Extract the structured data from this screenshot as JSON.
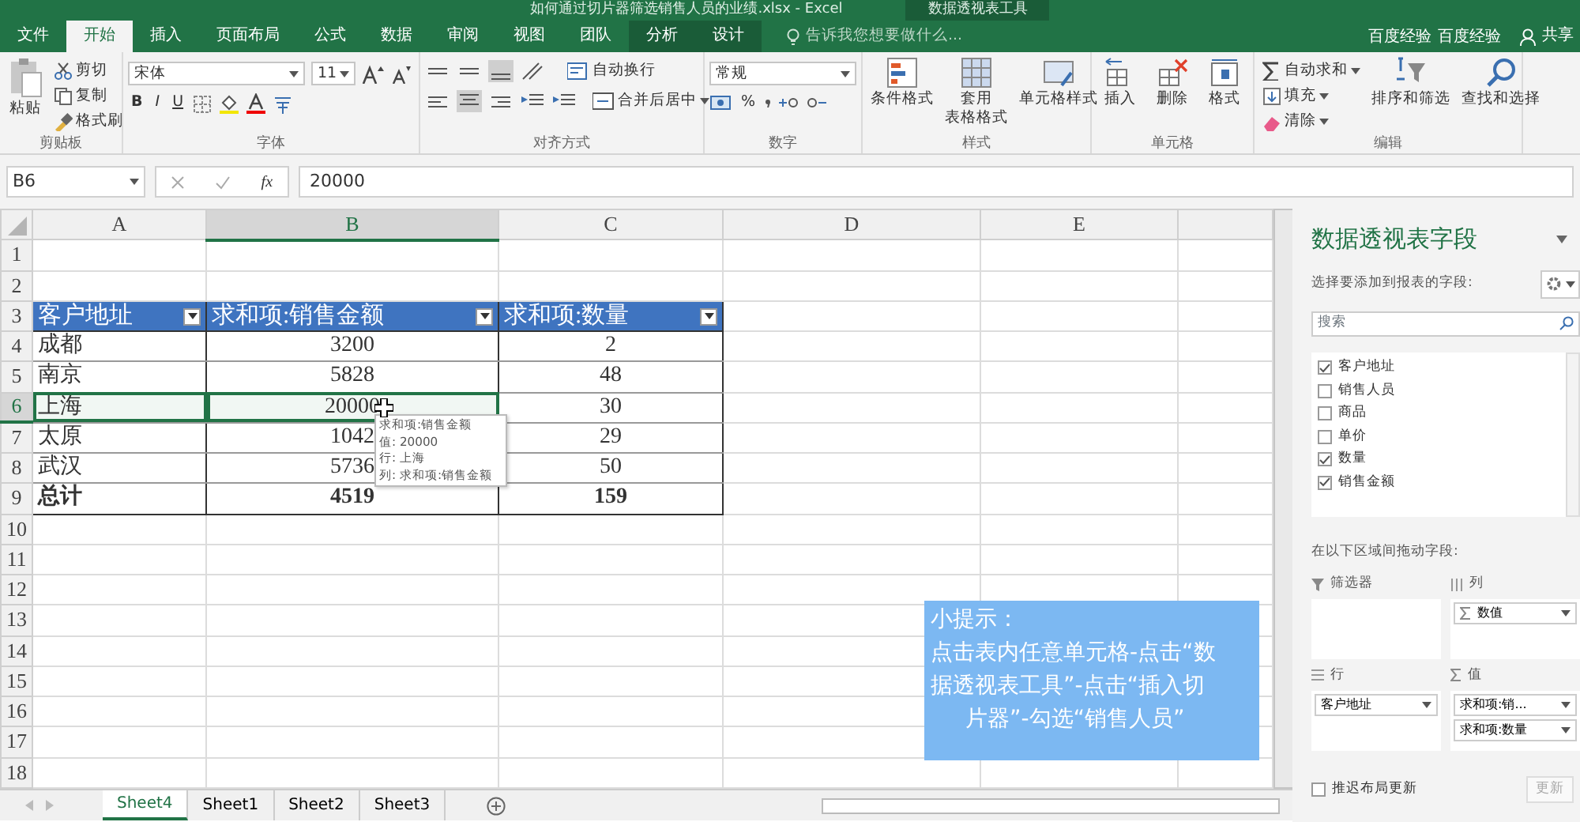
{
  "window": {
    "title": "如何通过切片器筛选销售人员的业绩.xlsx - Excel",
    "context_tab": "数据透视表工具",
    "tell_me": {
      "placeholder": "告诉我您想要做什么..."
    },
    "users": [
      "百度经验",
      "百度经验"
    ],
    "share": "共享"
  },
  "ribbon_tabs": [
    {
      "label": "文件",
      "selected": false,
      "kind": "standard"
    },
    {
      "label": "开始",
      "selected": true,
      "kind": "standard"
    },
    {
      "label": "插入",
      "selected": false,
      "kind": "standard"
    },
    {
      "label": "页面布局",
      "selected": false,
      "kind": "standard"
    },
    {
      "label": "公式",
      "selected": false,
      "kind": "standard"
    },
    {
      "label": "数据",
      "selected": false,
      "kind": "standard"
    },
    {
      "label": "审阅",
      "selected": false,
      "kind": "standard"
    },
    {
      "label": "视图",
      "selected": false,
      "kind": "standard"
    },
    {
      "label": "团队",
      "selected": false,
      "kind": "standard"
    },
    {
      "label": "分析",
      "selected": false,
      "kind": "context"
    },
    {
      "label": "设计",
      "selected": false,
      "kind": "context"
    }
  ],
  "ribbon": {
    "clipboard": {
      "label": "剪贴板",
      "paste": "粘贴",
      "commands": [
        "剪切",
        "复制",
        "格式刷"
      ]
    },
    "font": {
      "label": "字体",
      "font_name": "宋体",
      "font_size": "11",
      "bold": "B",
      "italic": "I",
      "underline": "U"
    },
    "alignment": {
      "label": "对齐方式",
      "wrap": "自动换行",
      "merge": "合并后居中"
    },
    "number": {
      "label": "数字",
      "format": "常规",
      "percent": "%"
    },
    "styles": {
      "label": "样式",
      "commands": [
        {
          "lines": [
            "条件格式"
          ]
        },
        {
          "lines": [
            "套用",
            "表格格式"
          ]
        },
        {
          "lines": [
            "单元格样式"
          ]
        }
      ]
    },
    "cells": {
      "label": "单元格",
      "commands": [
        "插入",
        "删除",
        "格式"
      ]
    },
    "editing": {
      "label": "编辑",
      "small": [
        "自动求和",
        "填充",
        "清除"
      ],
      "large": [
        "排序和筛选",
        "查找和选择"
      ]
    }
  },
  "formula_bar": {
    "name_box": "B6",
    "fx": "fx",
    "value": "20000"
  },
  "columns": [
    {
      "label": "A",
      "selected": false
    },
    {
      "label": "B",
      "selected": true
    },
    {
      "label": "C",
      "selected": false
    },
    {
      "label": "D",
      "selected": false
    },
    {
      "label": "E",
      "selected": false
    }
  ],
  "rows": [
    {
      "label": "1",
      "selected": false,
      "kind": "empty"
    },
    {
      "label": "2",
      "selected": false,
      "kind": "empty"
    },
    {
      "label": "3",
      "selected": false,
      "kind": "header",
      "cells": [
        {
          "text": "客户地址",
          "selected": false
        },
        {
          "text": "求和项:销售金额",
          "selected": false
        },
        {
          "text": "求和项:数量",
          "selected": false
        }
      ]
    },
    {
      "label": "4",
      "selected": false,
      "kind": "data",
      "cells": [
        {
          "text": "成都",
          "selected": false
        },
        {
          "text": "3200",
          "selected": false
        },
        {
          "text": "2",
          "selected": false
        }
      ]
    },
    {
      "label": "5",
      "selected": false,
      "kind": "data",
      "cells": [
        {
          "text": "南京",
          "selected": false
        },
        {
          "text": "5828",
          "selected": false
        },
        {
          "text": "48",
          "selected": false
        }
      ]
    },
    {
      "label": "6",
      "selected": true,
      "kind": "data",
      "cells": [
        {
          "text": "上海",
          "selected": true
        },
        {
          "text": "20000",
          "selected": true
        },
        {
          "text": "30",
          "selected": false
        }
      ]
    },
    {
      "label": "7",
      "selected": false,
      "kind": "data",
      "cells": [
        {
          "text": "太原",
          "selected": false
        },
        {
          "text": "1042",
          "selected": false
        },
        {
          "text": "29",
          "selected": false
        }
      ]
    },
    {
      "label": "8",
      "selected": false,
      "kind": "data",
      "cells": [
        {
          "text": "武汉",
          "selected": false
        },
        {
          "text": "5736",
          "selected": false
        },
        {
          "text": "50",
          "selected": false
        }
      ]
    },
    {
      "label": "9",
      "selected": false,
      "kind": "total",
      "cells": [
        {
          "text": "总计",
          "selected": false
        },
        {
          "text": "4519",
          "selected": false
        },
        {
          "text": "159",
          "selected": false
        }
      ]
    },
    {
      "label": "10",
      "selected": false,
      "kind": "empty"
    },
    {
      "label": "11",
      "selected": false,
      "kind": "empty"
    },
    {
      "label": "12",
      "selected": false,
      "kind": "empty"
    },
    {
      "label": "13",
      "selected": false,
      "kind": "empty"
    },
    {
      "label": "14",
      "selected": false,
      "kind": "empty"
    },
    {
      "label": "15",
      "selected": false,
      "kind": "empty"
    },
    {
      "label": "16",
      "selected": false,
      "kind": "empty"
    },
    {
      "label": "17",
      "selected": false,
      "kind": "empty"
    },
    {
      "label": "18",
      "selected": false,
      "kind": "empty"
    }
  ],
  "tooltip": {
    "lines": [
      "求和项:销售金额",
      "值: 20000",
      "行: 上海",
      "列: 求和项:销售金额"
    ]
  },
  "tip": {
    "lines": [
      "小提示：",
      "点击表内任意单元格-点击“数",
      "据透视表工具”-点击“插入切",
      "片器”-勾选“销售人员”"
    ]
  },
  "sheet_tabs": [
    {
      "label": "Sheet4",
      "selected": true
    },
    {
      "label": "Sheet1",
      "selected": false
    },
    {
      "label": "Sheet2",
      "selected": false
    },
    {
      "label": "Sheet3",
      "selected": false
    }
  ],
  "field_pane": {
    "title": "数据透视表字段",
    "subtitle": "选择要添加到报表的字段:",
    "search": {
      "placeholder": "搜索"
    },
    "fields": [
      {
        "label": "客户地址",
        "checked": true
      },
      {
        "label": "销售人员",
        "checked": false
      },
      {
        "label": "商品",
        "checked": false
      },
      {
        "label": "单价",
        "checked": false
      },
      {
        "label": "数量",
        "checked": true
      },
      {
        "label": "销售金额",
        "checked": true
      }
    ],
    "drag_hint": "在以下区域间拖动字段:",
    "areas": [
      {
        "kind": "filters",
        "label": "筛选器"
      },
      {
        "kind": "columns",
        "label": "列",
        "items": [
          "数值"
        ]
      },
      {
        "kind": "rows",
        "label": "行",
        "items": [
          "客户地址"
        ]
      },
      {
        "kind": "values",
        "label": "值",
        "items": [
          "求和项:销...",
          "求和项:数量"
        ]
      }
    ],
    "defer": {
      "label": "推迟布局更新",
      "checked": false
    },
    "update_button": {
      "label": "更新",
      "disabled": true
    }
  }
}
